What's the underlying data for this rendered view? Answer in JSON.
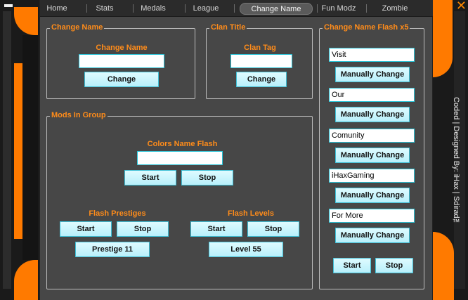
{
  "tabs": [
    "Home",
    "Stats",
    "Medals",
    "League",
    "Change Name",
    "Fun Modz",
    "Zombie"
  ],
  "active_tab": "Change Name",
  "credit": "Coded | Designed By: iHax | Sdirad™",
  "change_name": {
    "title": "Change Name",
    "label": "Change Name",
    "input_value": "",
    "button": "Change"
  },
  "clan_title": {
    "title": "Clan Title",
    "label": "Clan Tag",
    "input_value": "",
    "button": "Change"
  },
  "mods_group": {
    "title": "Mods In Group",
    "colors_label": "Colors Name Flash",
    "colors_input": "",
    "start": "Start",
    "stop": "Stop",
    "prestiges_label": "Flash Prestiges",
    "prestige_button": "Prestige 11",
    "levels_label": "Flash Levels",
    "level_button": "Level 55"
  },
  "flash_panel": {
    "title": "Change Name Flash x5",
    "entries": [
      {
        "value": "Visit",
        "button": "Manually Change"
      },
      {
        "value": "Our",
        "button": "Manually Change"
      },
      {
        "value": "Comunity",
        "button": "Manually Change"
      },
      {
        "value": "iHaxGaming",
        "button": "Manually Change"
      },
      {
        "value": "For More",
        "button": "Manually Change"
      }
    ],
    "start": "Start",
    "stop": "Stop"
  },
  "colors": {
    "accent": "#ff7a00",
    "label": "#ff8c1a",
    "button": "#b8f0fb",
    "panel": "#474747"
  }
}
